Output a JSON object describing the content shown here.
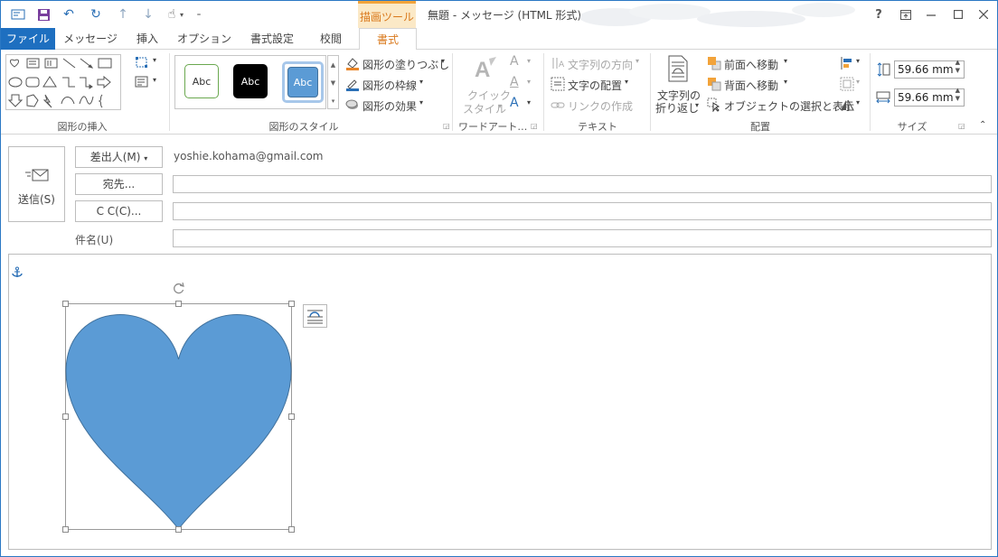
{
  "window": {
    "title": "無題 - メッセージ (HTML 形式)",
    "context_tool": "描画ツール",
    "help": "?"
  },
  "tabs": [
    "ファイル",
    "メッセージ",
    "挿入",
    "オプション",
    "書式設定",
    "校閲",
    "書式"
  ],
  "ribbon": {
    "groups": {
      "insert_shapes": "図形の挿入",
      "shape_styles": "図形のスタイル",
      "wordart": "ワードアート…",
      "text": "テキスト",
      "arrange": "配置",
      "size": "サイズ"
    },
    "style_samples": [
      "Abc",
      "Abc",
      "Abc"
    ],
    "shape_fill": "図形の塗りつぶし",
    "shape_outline": "図形の枠線",
    "shape_effects": "図形の効果",
    "quick_styles": "クイック\nスタイル",
    "quick_styles_line1": "クイック",
    "quick_styles_line2": "スタイル",
    "text_direction": "文字列の方向",
    "align_text": "文字の配置",
    "create_link": "リンクの作成",
    "wrap_text_line1": "文字列の",
    "wrap_text_line2": "折り返し",
    "bring_forward": "前面へ移動",
    "send_backward": "背面へ移動",
    "selection_pane": "オブジェクトの選択と表示",
    "height": "59.66 mm",
    "width": "59.66 mm"
  },
  "compose": {
    "send": "送信(S)",
    "from_button": "差出人(M)",
    "from_value": "yoshie.kohama@gmail.com",
    "to_button": "宛先...",
    "cc_button": "C C(C)...",
    "subject_label": "件名(U)",
    "to_value": "",
    "cc_value": "",
    "subject_value": ""
  },
  "colors": {
    "accent": "#1e6fc0",
    "context_tab": "#d9781b",
    "heart_fill": "#5b9bd5",
    "heart_outline": "#41719c"
  }
}
